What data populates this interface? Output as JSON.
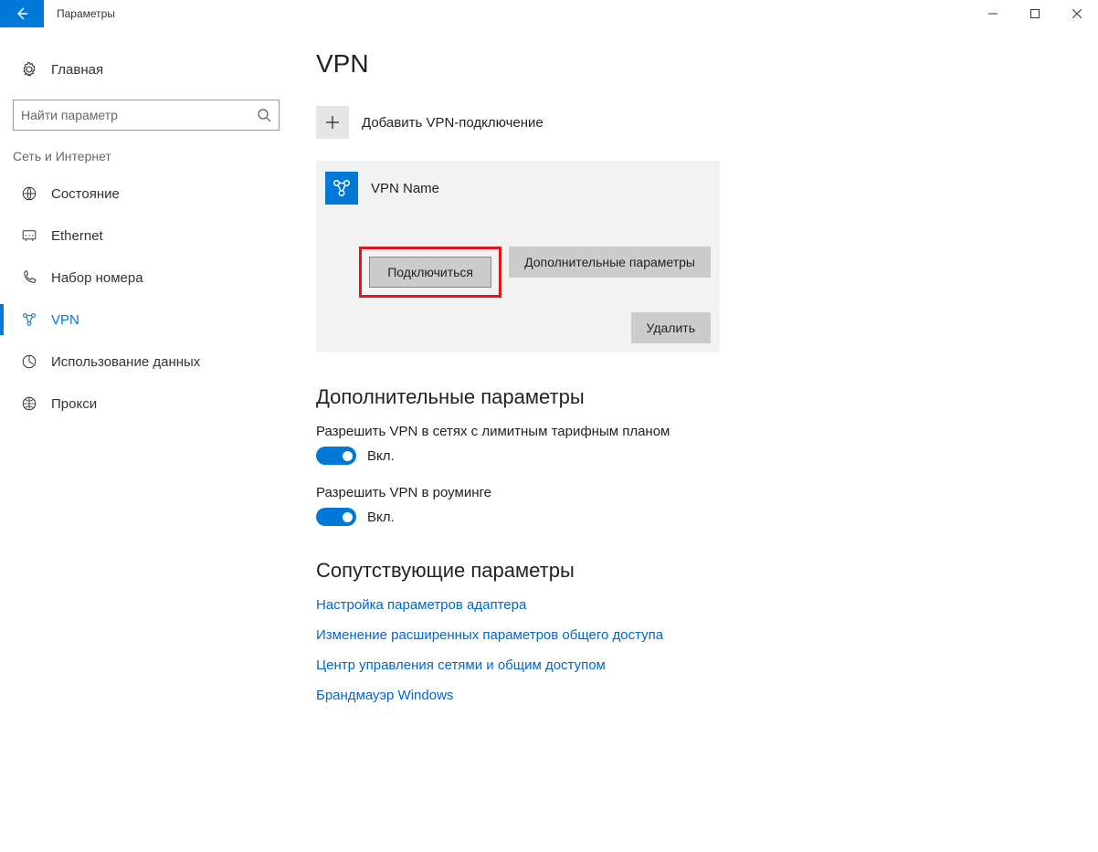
{
  "titlebar": {
    "title": "Параметры"
  },
  "sidebar": {
    "home": "Главная",
    "search_placeholder": "Найти параметр",
    "section": "Сеть и Интернет",
    "items": [
      {
        "label": "Состояние"
      },
      {
        "label": "Ethernet"
      },
      {
        "label": "Набор номера"
      },
      {
        "label": "VPN"
      },
      {
        "label": "Использование данных"
      },
      {
        "label": "Прокси"
      }
    ]
  },
  "page": {
    "title": "VPN",
    "add_vpn": "Добавить VPN-подключение",
    "vpn_name": "VPN Name",
    "connect_btn": "Подключиться",
    "advanced_btn": "Дополнительные параметры",
    "delete_btn": "Удалить",
    "advanced_heading": "Дополнительные параметры",
    "metered_label": "Разрешить VPN в сетях с лимитным тарифным планом",
    "roaming_label": "Разрешить VPN в роуминге",
    "toggle_on": "Вкл.",
    "related_heading": "Сопутствующие параметры",
    "links": [
      "Настройка параметров адаптера",
      "Изменение расширенных параметров общего доступа",
      "Центр управления сетями и общим доступом",
      "Брандмауэр Windows"
    ]
  }
}
